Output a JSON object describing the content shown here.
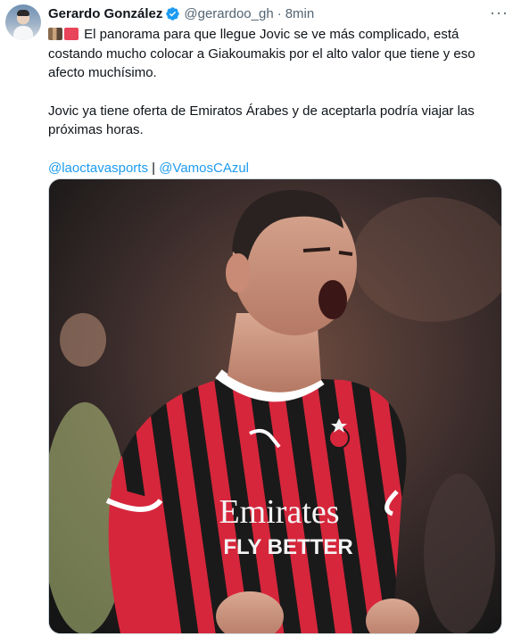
{
  "author": {
    "name": "Gerardo González",
    "handle": "@gerardoo_gh",
    "separator": "·",
    "time": "8min"
  },
  "icons": {
    "avatar": "profile-photo",
    "verified": "verified-badge-icon",
    "more": "more-options-icon"
  },
  "tweet": {
    "line1": "El panorama para que llegue Jovic se ve más complicado, está costando mucho colocar a Giakoumakis por el alto valor que tiene y eso afecto muchísimo.",
    "line2": "Jovic ya tiene oferta de Emiratos Árabes y de aceptarla podría viajar las próximas horas.",
    "mention1": "@laoctavasports",
    "divider": "|",
    "mention2": "@VamosCAzul"
  },
  "image": {
    "sponsor_top": "Emirates",
    "sponsor_bottom": "FLY BETTER"
  },
  "colors": {
    "link": "#1d9bf0",
    "verified": "#1d9bf0",
    "secondary_text": "#536471"
  }
}
